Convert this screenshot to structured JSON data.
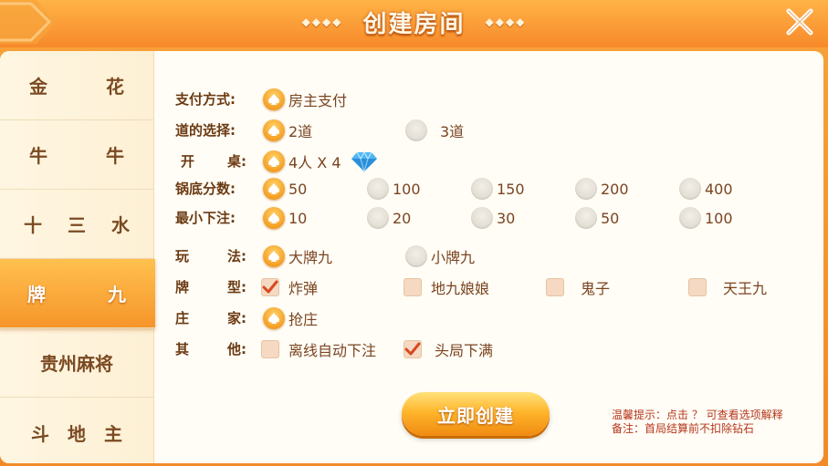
{
  "header": {
    "title": "创建房间",
    "ornament": "◆◆◆◆"
  },
  "sidebar": {
    "items": [
      {
        "label_a": "金",
        "label_b": "花"
      },
      {
        "label_a": "牛",
        "label_b": "牛"
      },
      {
        "label_a": "十",
        "label_b": "三",
        "label_c": "水"
      },
      {
        "label_a": "牌",
        "label_b": "九",
        "active": true
      },
      {
        "label": "贵州麻将"
      },
      {
        "label_a": "斗",
        "label_b": "地",
        "label_c": "主"
      }
    ]
  },
  "form": {
    "pay": {
      "label": "支付方式:",
      "options": [
        "房主支付"
      ],
      "selected": "房主支付"
    },
    "lanes": {
      "label": "道的选择:",
      "options": [
        "2道",
        "3道"
      ],
      "selected": "2道"
    },
    "table": {
      "label_a": "开",
      "label_b": "桌:",
      "value": "4人 X 4"
    },
    "pot": {
      "label": "锅底分数:",
      "options": [
        "50",
        "100",
        "150",
        "200",
        "400"
      ],
      "selected": "50"
    },
    "min_bet": {
      "label": "最小下注:",
      "options": [
        "10",
        "20",
        "30",
        "50",
        "100"
      ],
      "selected": "10"
    },
    "play": {
      "label_a": "玩",
      "label_b": "法:",
      "options": [
        "大牌九",
        "小牌九"
      ],
      "selected": "大牌九"
    },
    "card_type": {
      "label_a": "牌",
      "label_b": "型:",
      "options": [
        "炸弹",
        "地九娘娘",
        "鬼子",
        "天王九"
      ],
      "checked": [
        "炸弹"
      ]
    },
    "banker": {
      "label_a": "庄",
      "label_b": "家:",
      "options": [
        "抢庄"
      ],
      "selected": "抢庄"
    },
    "other": {
      "label_a": "其",
      "label_b": "他:",
      "options": [
        "离线自动下注",
        "头局下满"
      ],
      "checked": [
        "头局下满"
      ]
    }
  },
  "create_button": "立即创建",
  "tips": {
    "line1": "温馨提示：点击 ？ 可查看选项解释",
    "line2": "备注：首局结算前不扣除钻石"
  },
  "icons": [
    "back-arrow-icon",
    "close-icon",
    "spade-icon",
    "diamond-gem-icon",
    "check-mark-icon"
  ],
  "colors": {
    "accent": "#f39b1f",
    "header": "#f7892a",
    "text": "#7a4420",
    "tip": "#b5361a"
  }
}
